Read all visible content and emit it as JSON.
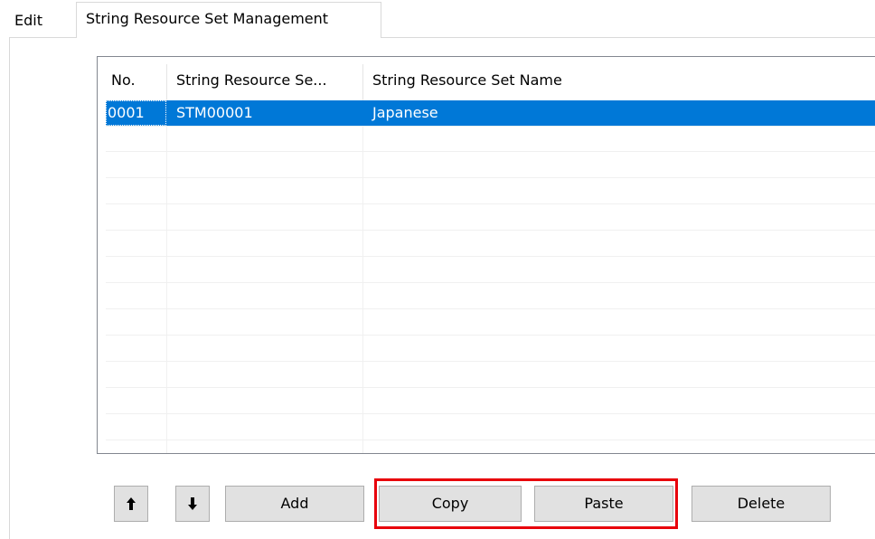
{
  "tabs": {
    "edit_label": "Edit",
    "active_label": "String Resource Set Management"
  },
  "list": {
    "columns": [
      "No.",
      "String Resource Se...",
      "String Resource Set Name"
    ],
    "rows": [
      {
        "no": "0001",
        "id": "STM00001",
        "name": "Japanese",
        "selected": true
      }
    ]
  },
  "buttons": {
    "up_icon": "arrow-up-icon",
    "down_icon": "arrow-down-icon",
    "add_label": "Add",
    "copy_label": "Copy",
    "paste_label": "Paste",
    "delete_label": "Delete"
  },
  "colors": {
    "selection": "#0078d7",
    "highlight": "#e8000b"
  }
}
